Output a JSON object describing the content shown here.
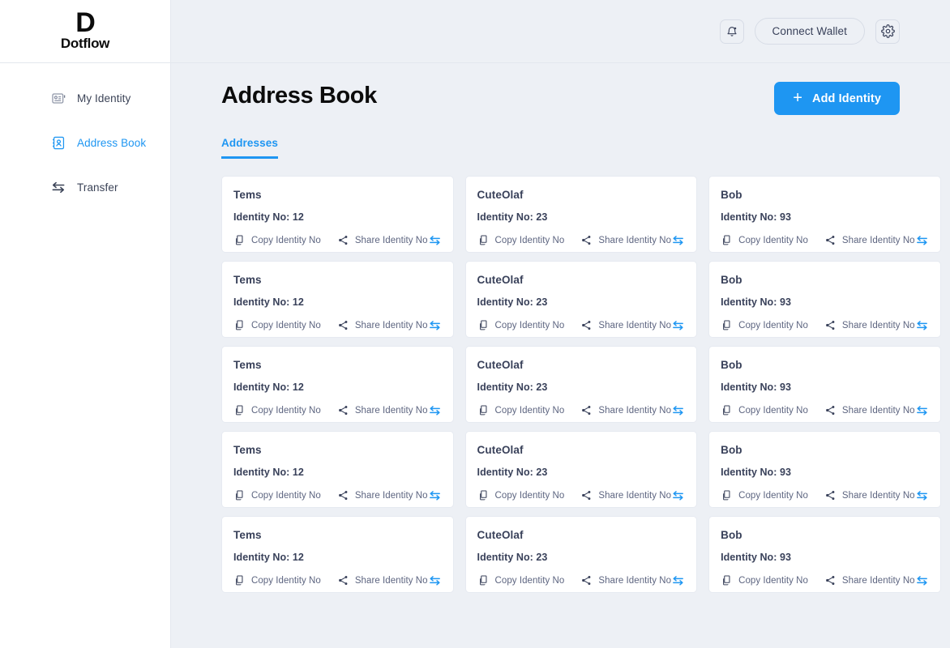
{
  "brand": {
    "mark": "D",
    "name": "Dotflow"
  },
  "sidebar": {
    "items": [
      {
        "label": "My Identity",
        "icon": "id-card-icon",
        "active": false
      },
      {
        "label": "Address Book",
        "icon": "address-book-icon",
        "active": true
      },
      {
        "label": "Transfer",
        "icon": "transfer-arrows-icon",
        "active": false
      }
    ]
  },
  "topbar": {
    "notifications_icon": "bell-icon",
    "connect_wallet_label": "Connect Wallet",
    "settings_icon": "gear-icon"
  },
  "page": {
    "title": "Address Book",
    "add_identity_label": "Add Identity",
    "add_identity_icon": "plus-icon"
  },
  "tabs": [
    {
      "label": "Addresses",
      "active": true
    }
  ],
  "card_actions": {
    "copy_label": "Copy Identity No",
    "copy_icon": "copy-icon",
    "share_label": "Share Identity No",
    "share_icon": "share-nodes-icon",
    "transfer_icon": "transfer-arrows-icon"
  },
  "colors": {
    "accent": "#1e96f2",
    "text": "#39415a",
    "muted": "#5d6580",
    "page_bg": "#edf0f5",
    "card_bg": "#ffffff",
    "border": "#e6eaf1"
  },
  "cards": [
    {
      "name": "Tems",
      "identity": "Identity No: 12"
    },
    {
      "name": "CuteOlaf",
      "identity": "Identity No: 23"
    },
    {
      "name": "Bob",
      "identity": "Identity No: 93"
    },
    {
      "name": "Tems",
      "identity": "Identity No: 12"
    },
    {
      "name": "CuteOlaf",
      "identity": "Identity No: 23"
    },
    {
      "name": "Bob",
      "identity": "Identity No: 93"
    },
    {
      "name": "Tems",
      "identity": "Identity No: 12"
    },
    {
      "name": "CuteOlaf",
      "identity": "Identity No: 23"
    },
    {
      "name": "Bob",
      "identity": "Identity No: 93"
    },
    {
      "name": "Tems",
      "identity": "Identity No: 12"
    },
    {
      "name": "CuteOlaf",
      "identity": "Identity No: 23"
    },
    {
      "name": "Bob",
      "identity": "Identity No: 93"
    },
    {
      "name": "Tems",
      "identity": "Identity No: 12"
    },
    {
      "name": "CuteOlaf",
      "identity": "Identity No: 23"
    },
    {
      "name": "Bob",
      "identity": "Identity No: 93"
    }
  ]
}
